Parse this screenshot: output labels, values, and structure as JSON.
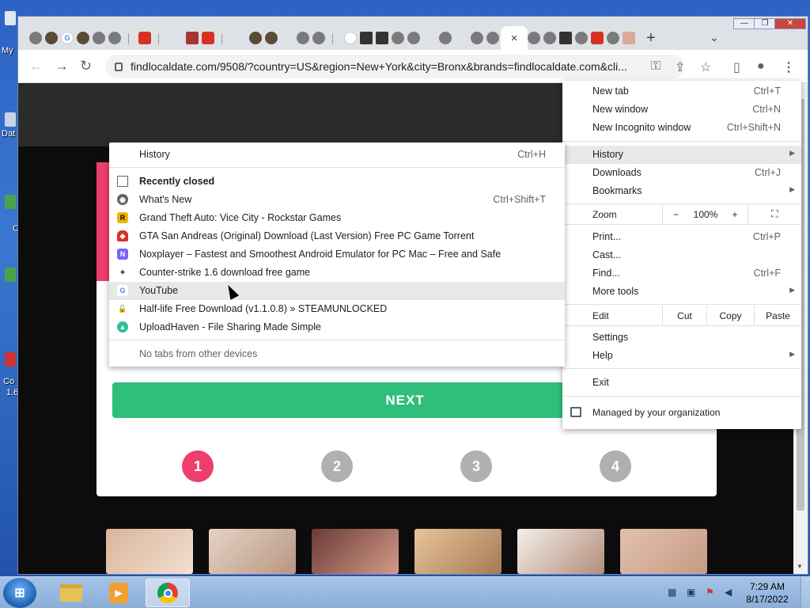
{
  "desktop": {
    "labels": [
      "My",
      "Dat",
      "C",
      "Co",
      "1.6"
    ]
  },
  "tabs": {
    "close_glyph": "×",
    "new_tab_glyph": "+",
    "list_glyph": "⌄",
    "favicon_letters": {
      "google": "G",
      "search": "🔍"
    }
  },
  "window_controls": {
    "minimize": "—",
    "restore": "❐",
    "close": "✕"
  },
  "toolbar": {
    "back": "←",
    "forward": "→",
    "reload": "↻",
    "url": "findlocaldate.com/9508/?country=US&region=New+York&city=Bronx&brands=findlocaldate.com&cli...",
    "key": "⚿",
    "share": "⇪",
    "star": "☆",
    "sidepanel": "▯",
    "profile": "●",
    "menu": "⋮"
  },
  "page": {
    "next_label": "NEXT",
    "steps": [
      "1",
      "2",
      "3",
      "4"
    ],
    "accent_color": "#ef3e6c",
    "next_color": "#2fbf7a"
  },
  "menu": {
    "new_tab": {
      "label": "New tab",
      "shortcut": "Ctrl+T"
    },
    "new_window": {
      "label": "New window",
      "shortcut": "Ctrl+N"
    },
    "incognito": {
      "label": "New Incognito window",
      "shortcut": "Ctrl+Shift+N"
    },
    "history": {
      "label": "History"
    },
    "downloads": {
      "label": "Downloads",
      "shortcut": "Ctrl+J"
    },
    "bookmarks": {
      "label": "Bookmarks"
    },
    "zoom": {
      "label": "Zoom",
      "minus": "−",
      "value": "100%",
      "plus": "+",
      "fullscreen": "⛶"
    },
    "print": {
      "label": "Print...",
      "shortcut": "Ctrl+P"
    },
    "cast": {
      "label": "Cast..."
    },
    "find": {
      "label": "Find...",
      "shortcut": "Ctrl+F"
    },
    "more_tools": {
      "label": "More tools"
    },
    "edit": {
      "label": "Edit",
      "cut": "Cut",
      "copy": "Copy",
      "paste": "Paste"
    },
    "settings": {
      "label": "Settings"
    },
    "help": {
      "label": "Help"
    },
    "exit": {
      "label": "Exit"
    },
    "managed": {
      "label": "Managed by your organization"
    }
  },
  "history_submenu": {
    "history": {
      "label": "History",
      "shortcut": "Ctrl+H"
    },
    "recently_closed": "Recently closed",
    "items": [
      {
        "label": "What's New",
        "shortcut": "Ctrl+Shift+T",
        "icon": "chrome-icon",
        "color": "#5f6368",
        "glyph": "◉"
      },
      {
        "label": "Grand Theft Auto: Vice City - Rockstar Games",
        "icon": "rockstar-icon",
        "color": "#f0b400",
        "glyph": "R"
      },
      {
        "label": "GTA San Andreas (Original) Download (Last Version) Free PC Game Torrent",
        "icon": "ghost-icon",
        "color": "#d93025",
        "glyph": "◆"
      },
      {
        "label": "Noxplayer – Fastest and Smoothest Android Emulator for PC  Mac – Free and Safe",
        "icon": "nox-icon",
        "color": "#7b61ff",
        "glyph": "N"
      },
      {
        "label": "Counter-strike 1.6 download free game",
        "icon": "cs-icon",
        "color": "#8a6d3b",
        "glyph": "✦"
      },
      {
        "label": "YouTube",
        "icon": "google-icon",
        "color": "#ffffff",
        "glyph": "G"
      },
      {
        "label": "Half-life Free Download (v1.1.0.8) » STEAMUNLOCKED",
        "icon": "lock-icon",
        "color": "#d93025",
        "glyph": "🔓"
      },
      {
        "label": "UploadHaven - File Sharing Made Simple",
        "icon": "upload-icon",
        "color": "#2fbf9a",
        "glyph": "▲"
      }
    ],
    "no_tabs": "No tabs from other devices"
  },
  "taskbar": {
    "start": "⊞",
    "time": "7:29 AM",
    "date": "8/17/2022"
  }
}
